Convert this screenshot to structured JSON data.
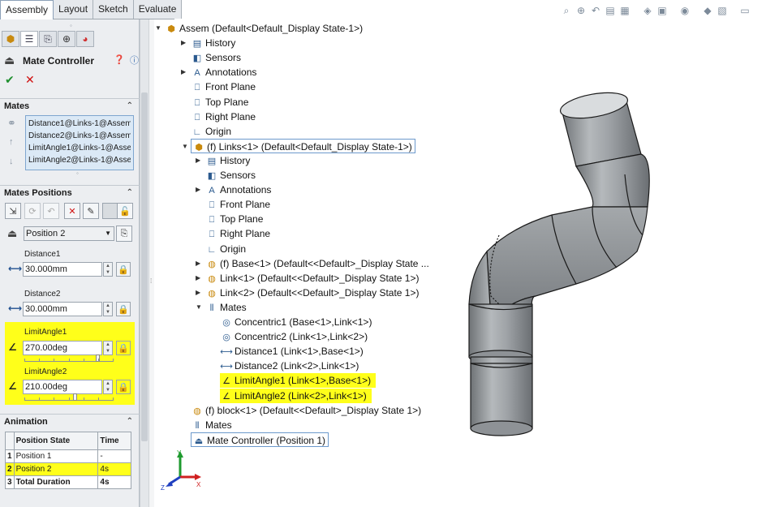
{
  "tabs": [
    {
      "label": "Assembly",
      "active": true
    },
    {
      "label": "Layout",
      "active": false
    },
    {
      "label": "Sketch",
      "active": false
    },
    {
      "label": "Evaluate",
      "active": false
    }
  ],
  "toolbar_icons": [
    "zoom-to-fit-icon",
    "zoom-area-icon",
    "previous-view-icon",
    "section-view-icon",
    "dynamic-annotation-icon",
    "view-orientation-icon",
    "display-style-icon",
    "hide-show-icon",
    "edit-appearance-icon",
    "apply-scene-icon",
    "view-settings-icon"
  ],
  "panel": {
    "title": "Mate Controller",
    "mates_section": "Mates",
    "mates": [
      "Distance1@Links-1@Assem",
      "Distance2@Links-1@Assem",
      "LimitAngle1@Links-1@Assem",
      "LimitAngle2@Links-1@Assem"
    ],
    "positions_section": "Mates Positions",
    "position_select": "Position 2",
    "fields": [
      {
        "label": "Distance1",
        "value": "30.000mm",
        "highlight": false
      },
      {
        "label": "Distance2",
        "value": "30.000mm",
        "highlight": false
      },
      {
        "label": "LimitAngle1",
        "value": "270.00deg",
        "highlight": true,
        "slider": 0.85
      },
      {
        "label": "LimitAngle2",
        "value": "210.00deg",
        "highlight": true,
        "slider": 0.58
      }
    ],
    "animation_section": "Animation",
    "table": {
      "headers": [
        "Position State",
        "Time"
      ],
      "rows": [
        {
          "num": "1",
          "state": "Position 1",
          "time": "-",
          "highlight": false,
          "bold": false
        },
        {
          "num": "2",
          "state": "Position 2",
          "time": "4s",
          "highlight": true,
          "bold": false
        },
        {
          "num": "3",
          "state": "Total Duration",
          "time": "4s",
          "highlight": false,
          "bold": true
        }
      ]
    }
  },
  "tree": [
    {
      "label": "Assem  (Default<Default_Display State-1>)",
      "icon": "assembly-icon",
      "arrow": "down"
    },
    {
      "label": "History",
      "icon": "history-icon",
      "arrow": "right"
    },
    {
      "label": "Sensors",
      "icon": "sensors-icon",
      "arrow": ""
    },
    {
      "label": "Annotations",
      "icon": "annotations-icon",
      "arrow": "right"
    },
    {
      "label": "Front Plane",
      "icon": "plane-icon",
      "arrow": ""
    },
    {
      "label": "Top Plane",
      "icon": "plane-icon",
      "arrow": ""
    },
    {
      "label": "Right Plane",
      "icon": "plane-icon",
      "arrow": ""
    },
    {
      "label": "Origin",
      "icon": "origin-icon",
      "arrow": ""
    },
    {
      "label": "(f) Links<1> (Default<Default_Display State-1>)",
      "icon": "subassembly-icon",
      "arrow": "down",
      "boxed": true
    },
    {
      "label": "History",
      "icon": "history-icon",
      "arrow": "right"
    },
    {
      "label": "Sensors",
      "icon": "sensors-icon",
      "arrow": ""
    },
    {
      "label": "Annotations",
      "icon": "annotations-icon",
      "arrow": "right"
    },
    {
      "label": "Front Plane",
      "icon": "plane-icon",
      "arrow": ""
    },
    {
      "label": "Top Plane",
      "icon": "plane-icon",
      "arrow": ""
    },
    {
      "label": "Right Plane",
      "icon": "plane-icon",
      "arrow": ""
    },
    {
      "label": "Origin",
      "icon": "origin-icon",
      "arrow": ""
    },
    {
      "label": "(f) Base<1> (Default<<Default>_Display State ...",
      "icon": "part-icon",
      "arrow": "right"
    },
    {
      "label": "Link<1> (Default<<Default>_Display State 1>)",
      "icon": "part-icon",
      "arrow": "right"
    },
    {
      "label": "Link<2> (Default<<Default>_Display State 1>)",
      "icon": "part-icon",
      "arrow": "right"
    },
    {
      "label": "Mates",
      "icon": "mates-icon",
      "arrow": "down"
    },
    {
      "label": "Concentric1 (Base<1>,Link<1>)",
      "icon": "concentric-icon",
      "arrow": ""
    },
    {
      "label": "Concentric2 (Link<1>,Link<2>)",
      "icon": "concentric-icon",
      "arrow": ""
    },
    {
      "label": "Distance1 (Link<1>,Base<1>)",
      "icon": "distance-icon",
      "arrow": ""
    },
    {
      "label": "Distance2 (Link<2>,Link<1>)",
      "icon": "distance-icon",
      "arrow": ""
    },
    {
      "label": "LimitAngle1 (Link<1>,Base<1>)",
      "icon": "limit-angle-icon",
      "arrow": "",
      "highlight": true
    },
    {
      "label": "LimitAngle2 (Link<2>,Link<1>)",
      "icon": "limit-angle-icon",
      "arrow": "",
      "highlight": true
    },
    {
      "label": "(f) block<1> (Default<<Default>_Display State 1>)",
      "icon": "part-icon",
      "arrow": ""
    },
    {
      "label": "Mates",
      "icon": "mates-icon",
      "arrow": ""
    },
    {
      "label": "Mate Controller (Position 1)",
      "icon": "mate-controller-icon",
      "arrow": "",
      "boxed": true
    }
  ],
  "triad": {
    "x": "X",
    "y": "Y",
    "z": "Z"
  },
  "colors": {
    "highlight": "#ffff1a",
    "accent": "#2b5a8e",
    "ok": "#1e8f2e",
    "cancel": "#d01010"
  }
}
